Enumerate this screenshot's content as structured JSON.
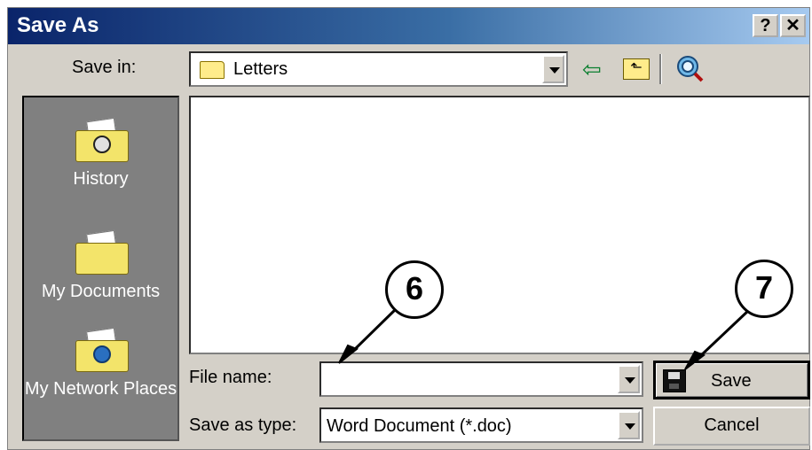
{
  "window": {
    "title": "Save As",
    "help_label": "?",
    "close_label": "✕"
  },
  "toolbar": {
    "save_in_label": "Save in:",
    "save_in_value": "Letters",
    "icons": [
      "folder-icon",
      "back-arrow-icon",
      "up-one-level-icon",
      "search-web-icon"
    ]
  },
  "places": [
    {
      "label": "History",
      "icon": "history-folder-icon"
    },
    {
      "label": "My Documents",
      "icon": "my-documents-folder-icon"
    },
    {
      "label": "My Network Places",
      "icon": "network-folder-icon"
    }
  ],
  "form": {
    "file_name_label": "File name:",
    "file_name_value": "",
    "save_as_type_label": "Save as type:",
    "save_as_type_value": "Word Document (*.doc)"
  },
  "buttons": {
    "save_label": "Save",
    "cancel_label": "Cancel"
  },
  "callouts": [
    "6",
    "7"
  ],
  "colors": {
    "title_start": "#0a246a",
    "title_end": "#a6caf0",
    "dialog_bg": "#d4d0c8",
    "places_bg": "#808080"
  }
}
